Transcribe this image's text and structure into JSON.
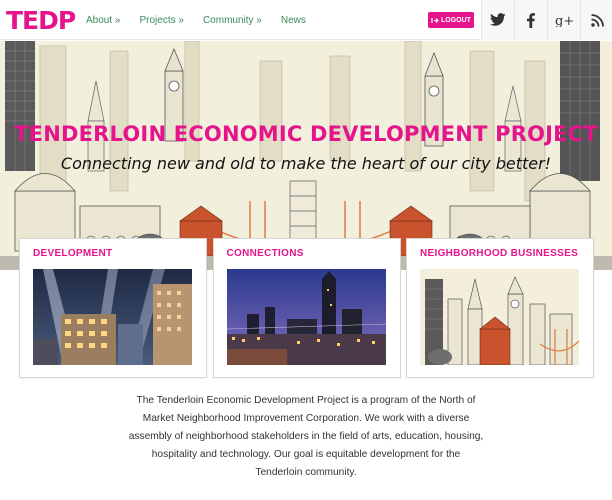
{
  "header": {
    "logo_text": "TEDP",
    "nav": [
      {
        "label": "About »"
      },
      {
        "label": "Projects »"
      },
      {
        "label": "Community »"
      },
      {
        "label": "News"
      }
    ],
    "logout_label": "LOGOUT",
    "logout_icon": "logout-arrow-icon",
    "social": [
      {
        "icon": "twitter-icon",
        "glyph": "t"
      },
      {
        "icon": "facebook-icon",
        "glyph": "f"
      },
      {
        "icon": "google-plus-icon",
        "glyph": "G+"
      },
      {
        "icon": "rss-icon",
        "glyph": "rss"
      }
    ]
  },
  "hero": {
    "title": "TENDERLOIN ECONOMIC DEVELOPMENT PROJECT",
    "subtitle": "Connecting new and old to make the heart of our city better!"
  },
  "cards": [
    {
      "title": "DEVELOPMENT"
    },
    {
      "title": "CONNECTIONS"
    },
    {
      "title": "NEIGHBORHOOD BUSINESSES"
    }
  ],
  "intro": {
    "lines": [
      "The Tenderloin Economic Development Project is a program of the North of",
      "Market Neighborhood Improvement Corporation. We work with a diverse",
      "assembly of neighborhood stakeholders in the field of arts, education, housing,",
      "hospitality and technology. Our goal is equitable development for the",
      "Tenderloin community."
    ]
  },
  "colors": {
    "brand": "#e6148c",
    "nav_link": "#3b8a5a",
    "hero_bg": "#f2efdc",
    "text": "#333333"
  }
}
